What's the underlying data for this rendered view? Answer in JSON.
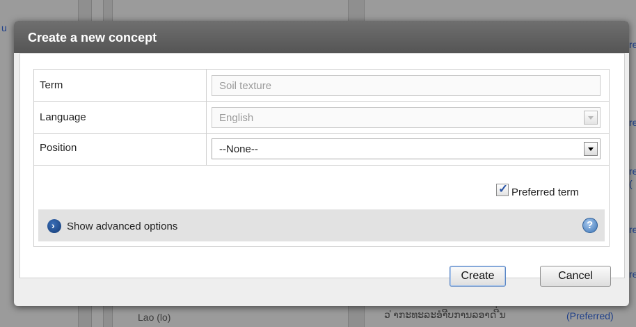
{
  "background": {
    "left_snippet": "u",
    "row_language": "Lao (lo)",
    "row_term": "ວ ່າກະທະລະອຳີບການລອາດ ີ່ນ",
    "row_status": "(Preferred)",
    "right_snippets": [
      "re",
      "re",
      "re",
      "(",
      "re",
      "re"
    ]
  },
  "dialog": {
    "title": "Create a new concept",
    "form": {
      "term": {
        "label": "Term",
        "placeholder": "Soil texture"
      },
      "language": {
        "label": "Language",
        "value": "English"
      },
      "position": {
        "label": "Position",
        "value": "--None--"
      }
    },
    "preferred": {
      "label": "Preferred term",
      "checked": true,
      "tick": "✓"
    },
    "advanced": {
      "label": "Show advanced options",
      "icon": "chevron-right-icon",
      "glyph": "›"
    },
    "help": {
      "icon": "help-icon",
      "glyph": "?"
    },
    "buttons": {
      "create": "Create",
      "cancel": "Cancel"
    }
  }
}
